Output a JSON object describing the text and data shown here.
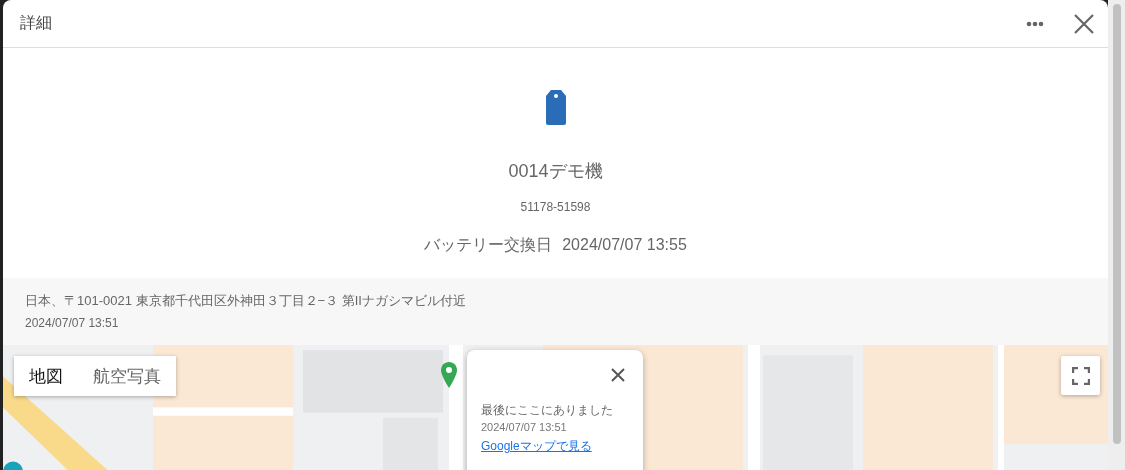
{
  "dialog": {
    "title": "詳細"
  },
  "device": {
    "name": "0014デモ機",
    "id": "51178-51598",
    "battery_label": "バッテリー交換日",
    "battery_date": "2024/07/07 13:55"
  },
  "location": {
    "address": "日本、〒101-0021 東京都千代田区外神田３丁目２−３ 第IIナガシマビル付近",
    "time": "2024/07/07 13:51"
  },
  "map": {
    "map_types": [
      {
        "label": "地図",
        "selected": true
      },
      {
        "label": "航空写真",
        "selected": false
      }
    ],
    "info_window": {
      "message": "最後にここにありました",
      "time": "2024/07/07 13:51",
      "link": "Googleマップで見る"
    }
  }
}
